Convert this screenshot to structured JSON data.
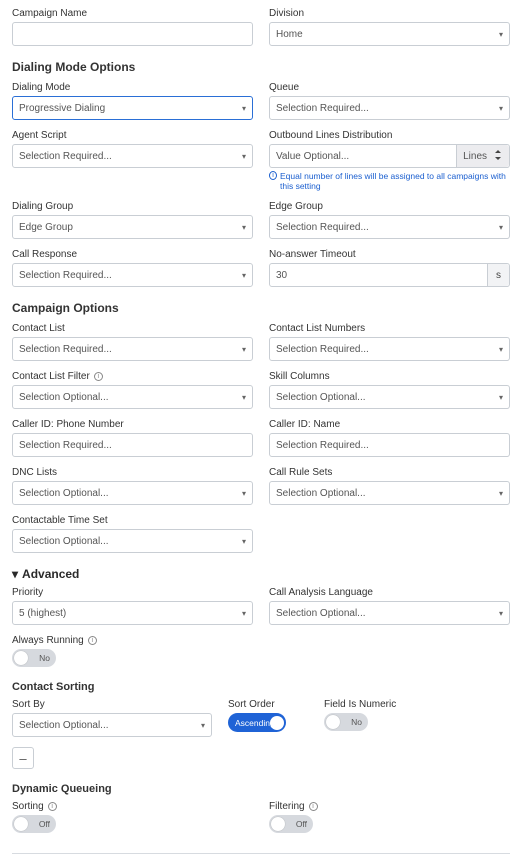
{
  "top": {
    "campaign_name_label": "Campaign Name",
    "campaign_name_value": "",
    "division_label": "Division",
    "division_value": "Home"
  },
  "dialing_section": "Dialing Mode Options",
  "dialing": {
    "mode_label": "Dialing Mode",
    "mode_value": "Progressive Dialing",
    "queue_label": "Queue",
    "queue_value": "Selection Required...",
    "agent_script_label": "Agent Script",
    "agent_script_value": "Selection Required...",
    "outbound_label": "Outbound Lines Distribution",
    "outbound_value": "Value Optional...",
    "outbound_addon": "Lines",
    "outbound_note": "Equal number of lines will be assigned to all campaigns with this setting",
    "dialing_group_label": "Dialing Group",
    "dialing_group_value": "Edge Group",
    "edge_group_label": "Edge Group",
    "edge_group_value": "Selection Required...",
    "call_response_label": "Call Response",
    "call_response_value": "Selection Required...",
    "noanswer_label": "No-answer Timeout",
    "noanswer_value": "30",
    "noanswer_unit": "s"
  },
  "campaign_section": "Campaign Options",
  "campaign": {
    "contact_list_label": "Contact List",
    "contact_list_value": "Selection Required...",
    "contact_list_numbers_label": "Contact List Numbers",
    "contact_list_numbers_value": "Selection Required...",
    "contact_list_filter_label": "Contact List Filter",
    "contact_list_filter_value": "Selection Optional...",
    "skill_columns_label": "Skill Columns",
    "skill_columns_value": "Selection Optional...",
    "caller_id_phone_label": "Caller ID: Phone Number",
    "caller_id_phone_value": "Selection Required...",
    "caller_id_name_label": "Caller ID: Name",
    "caller_id_name_value": "Selection Required...",
    "dnc_label": "DNC Lists",
    "dnc_value": "Selection Optional...",
    "rule_sets_label": "Call Rule Sets",
    "rule_sets_value": "Selection Optional...",
    "contactable_time_label": "Contactable Time Set",
    "contactable_time_value": "Selection Optional..."
  },
  "advanced_header": "Advanced",
  "advanced": {
    "priority_label": "Priority",
    "priority_value": "5 (highest)",
    "call_analysis_lang_label": "Call Analysis Language",
    "call_analysis_lang_value": "Selection Optional...",
    "always_running_label": "Always Running",
    "always_running_state": "No"
  },
  "sorting_section": "Contact Sorting",
  "sorting": {
    "sort_by_label": "Sort By",
    "sort_by_value": "Selection Optional...",
    "sort_order_label": "Sort Order",
    "sort_order_value": "Ascending",
    "field_numeric_label": "Field Is Numeric",
    "field_numeric_state": "No",
    "minus": "–"
  },
  "dynq_section": "Dynamic Queueing",
  "dynq": {
    "sorting_label": "Sorting",
    "sorting_state": "Off",
    "filtering_label": "Filtering",
    "filtering_state": "Off"
  }
}
